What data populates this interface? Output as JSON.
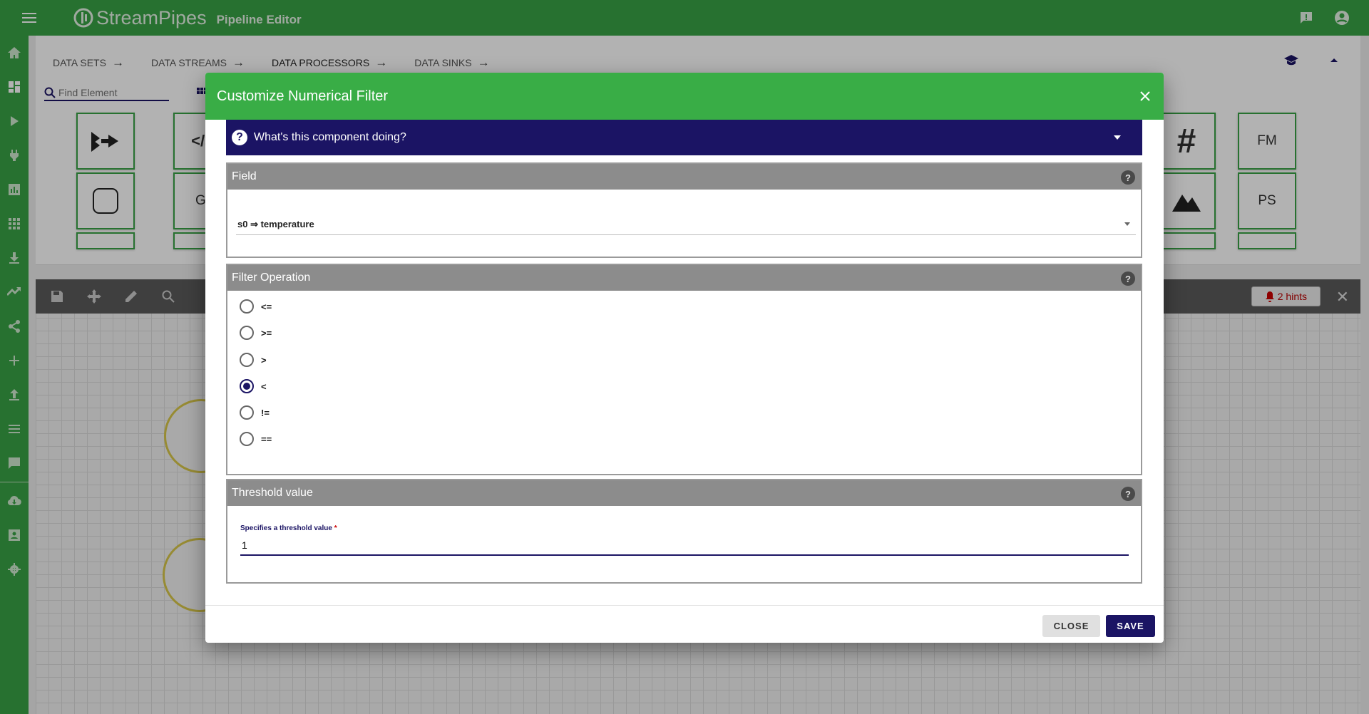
{
  "app": {
    "name": "StreamPipes",
    "page": "Pipeline Editor"
  },
  "editor": {
    "tabs": [
      "DATA SETS",
      "DATA STREAMS",
      "DATA PROCESSORS",
      "DATA SINKS"
    ],
    "active_tab": "DATA PROCESSORS",
    "search_placeholder": "Find Element",
    "tiles": {
      "gi": "GI",
      "fm": "FM",
      "ps": "PS",
      "hash": "#"
    },
    "hints_label": "2 hints"
  },
  "dialog": {
    "title": "Customize Numerical Filter",
    "help_label": "What's this component doing?",
    "field_section": {
      "title": "Field",
      "selected": "s0 ⇒ temperature"
    },
    "filter_section": {
      "title": "Filter Operation",
      "options": [
        "<=",
        ">=",
        ">",
        "<",
        "!=",
        "=="
      ],
      "selected": "<"
    },
    "threshold_section": {
      "title": "Threshold value",
      "label": "Specifies a threshold value",
      "required_mark": "*",
      "value": "1"
    },
    "buttons": {
      "close": "CLOSE",
      "save": "SAVE"
    }
  },
  "colors": {
    "brand_green": "#39a346",
    "header_green": "#39ad46",
    "accent_navy": "#1b1464",
    "section_gray": "#8c8c8c"
  }
}
